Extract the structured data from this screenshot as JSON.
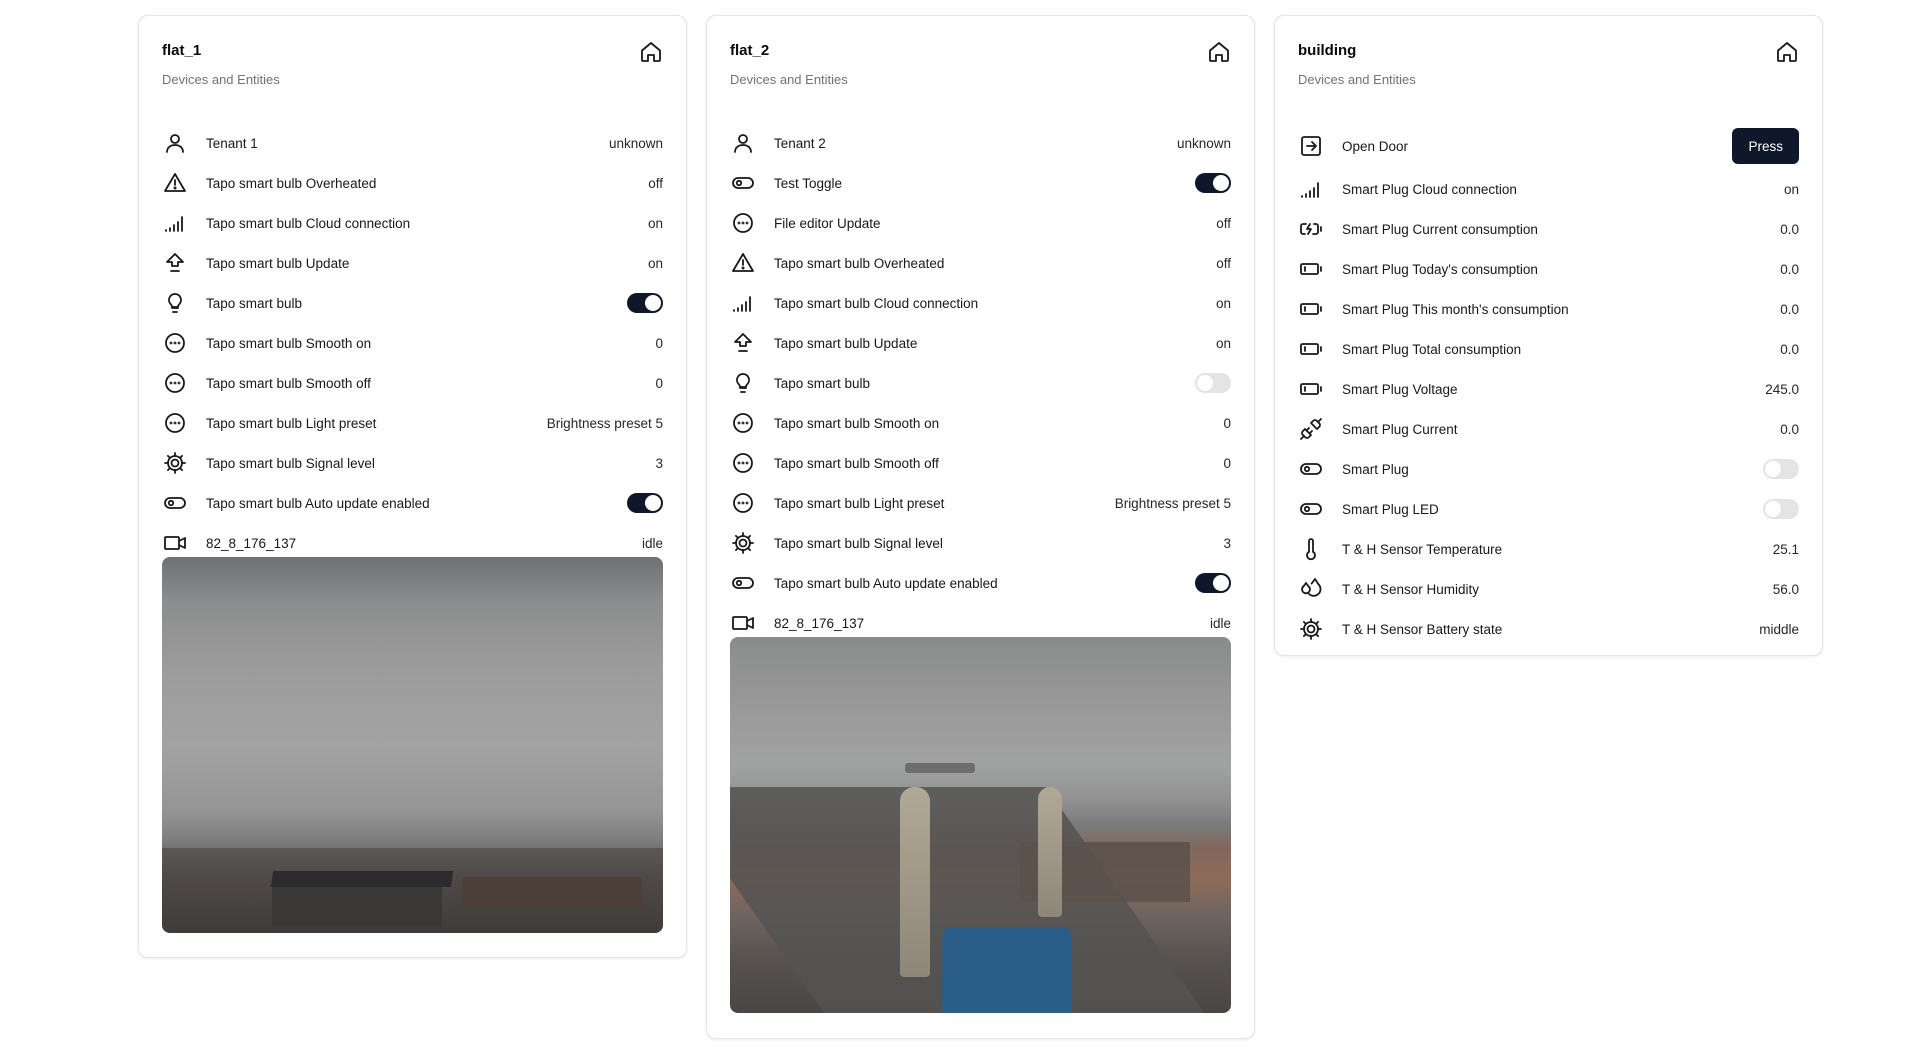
{
  "cards": [
    {
      "title": "flat_1",
      "subtitle": "Devices and Entities",
      "rows": [
        {
          "icon": "person-icon",
          "label": "Tenant 1",
          "value": "unknown"
        },
        {
          "icon": "warning-icon",
          "label": "Tapo smart bulb Overheated",
          "value": "off"
        },
        {
          "icon": "signal-icon",
          "label": "Tapo smart bulb Cloud connection",
          "value": "on"
        },
        {
          "icon": "update-icon",
          "label": "Tapo smart bulb Update",
          "value": "on"
        },
        {
          "icon": "bulb-icon",
          "label": "Tapo smart bulb",
          "toggle": true
        },
        {
          "icon": "dots-circle-icon",
          "label": "Tapo smart bulb Smooth on",
          "value": "0"
        },
        {
          "icon": "dots-circle-icon",
          "label": "Tapo smart bulb Smooth off",
          "value": "0"
        },
        {
          "icon": "dots-circle-icon",
          "label": "Tapo smart bulb Light preset",
          "value": "Brightness preset 5"
        },
        {
          "icon": "gear-icon",
          "label": "Tapo smart bulb Signal level",
          "value": "3"
        },
        {
          "icon": "toggle-icon",
          "label": "Tapo smart bulb Auto update enabled",
          "toggle": true
        },
        {
          "icon": "camera-icon",
          "label": "82_8_176_137",
          "value": "idle"
        }
      ]
    },
    {
      "title": "flat_2",
      "subtitle": "Devices and Entities",
      "rows": [
        {
          "icon": "person-icon",
          "label": "Tenant 2",
          "value": "unknown"
        },
        {
          "icon": "toggle-icon",
          "label": "Test Toggle",
          "toggle": true
        },
        {
          "icon": "dots-circle-icon",
          "label": "File editor Update",
          "value": "off"
        },
        {
          "icon": "warning-icon",
          "label": "Tapo smart bulb Overheated",
          "value": "off"
        },
        {
          "icon": "signal-icon",
          "label": "Tapo smart bulb Cloud connection",
          "value": "on"
        },
        {
          "icon": "update-icon",
          "label": "Tapo smart bulb Update",
          "value": "on"
        },
        {
          "icon": "bulb-icon",
          "label": "Tapo smart bulb",
          "toggle": false
        },
        {
          "icon": "dots-circle-icon",
          "label": "Tapo smart bulb Smooth on",
          "value": "0"
        },
        {
          "icon": "dots-circle-icon",
          "label": "Tapo smart bulb Smooth off",
          "value": "0"
        },
        {
          "icon": "dots-circle-icon",
          "label": "Tapo smart bulb Light preset",
          "value": "Brightness preset 5"
        },
        {
          "icon": "gear-icon",
          "label": "Tapo smart bulb Signal level",
          "value": "3"
        },
        {
          "icon": "toggle-icon",
          "label": "Tapo smart bulb Auto update enabled",
          "toggle": true
        },
        {
          "icon": "camera-icon",
          "label": "82_8_176_137",
          "value": "idle"
        }
      ]
    },
    {
      "title": "building",
      "subtitle": "Devices and Entities",
      "rows": [
        {
          "icon": "door-icon",
          "label": "Open Door",
          "button": "Press"
        },
        {
          "icon": "signal-icon",
          "label": "Smart Plug Cloud connection",
          "value": "on"
        },
        {
          "icon": "battery-charging-icon",
          "label": "Smart Plug Current consumption",
          "value": "0.0"
        },
        {
          "icon": "battery-icon",
          "label": "Smart Plug Today's consumption",
          "value": "0.0"
        },
        {
          "icon": "battery-icon",
          "label": "Smart Plug This month's consumption",
          "value": "0.0"
        },
        {
          "icon": "battery-icon",
          "label": "Smart Plug Total consumption",
          "value": "0.0"
        },
        {
          "icon": "battery-icon",
          "label": "Smart Plug Voltage",
          "value": "245.0"
        },
        {
          "icon": "plug-icon",
          "label": "Smart Plug Current",
          "value": "0.0"
        },
        {
          "icon": "toggle-icon",
          "label": "Smart Plug",
          "toggle": false
        },
        {
          "icon": "toggle-icon",
          "label": "Smart Plug LED",
          "toggle": false
        },
        {
          "icon": "thermometer-icon",
          "label": "T & H Sensor Temperature",
          "value": "25.1"
        },
        {
          "icon": "droplets-icon",
          "label": "T & H Sensor Humidity",
          "value": "56.0"
        },
        {
          "icon": "gear-icon",
          "label": "T & H Sensor Battery state",
          "value": "middle"
        }
      ]
    }
  ],
  "colors": {
    "accent": "#0f172a",
    "toggle_off": "#e4e4e7",
    "subtitle": "#71717a",
    "border": "#e4e4e7"
  }
}
